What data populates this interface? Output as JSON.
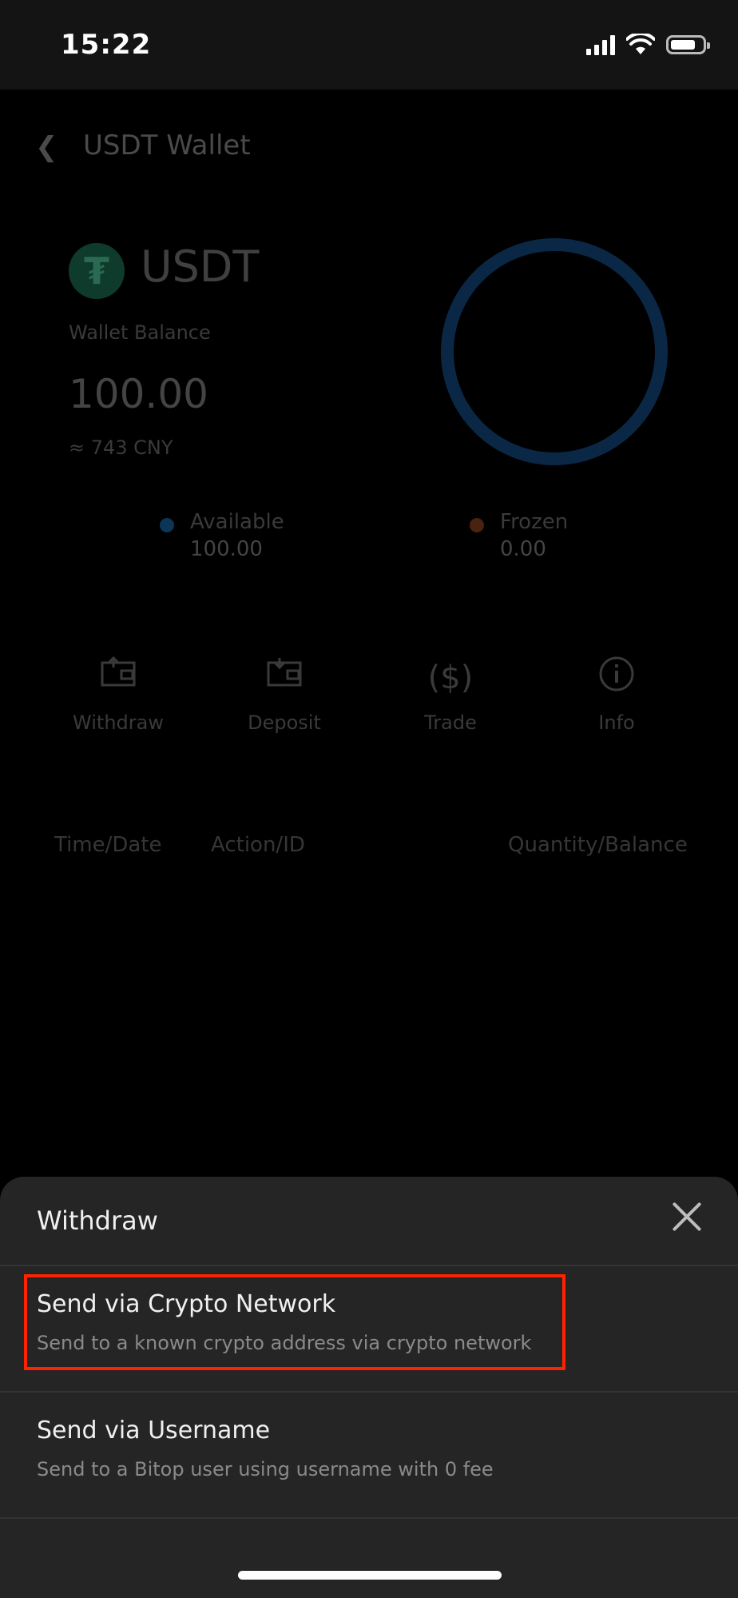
{
  "status": {
    "time": "15:22"
  },
  "header": {
    "title": "USDT Wallet"
  },
  "wallet": {
    "coin": "USDT",
    "coin_symbol": "₮",
    "balance_label": "Wallet Balance",
    "balance": "100.00",
    "balance_cny": "≈ 743 CNY",
    "available_label": "Available",
    "available_value": "100.00",
    "frozen_label": "Frozen",
    "frozen_value": "0.00"
  },
  "actions": [
    {
      "label": "Withdraw"
    },
    {
      "label": "Deposit"
    },
    {
      "label": "Trade"
    },
    {
      "label": "Info"
    }
  ],
  "table": {
    "columns": [
      "Time/Date",
      "Action/ID",
      "Quantity/Balance"
    ]
  },
  "sheet": {
    "title": "Withdraw",
    "options": [
      {
        "title": "Send via Crypto Network",
        "subtitle": "Send to a known crypto address via crypto network"
      },
      {
        "title": "Send via Username",
        "subtitle": "Send to a Bitop user using username with 0 fee"
      }
    ]
  },
  "colors": {
    "accent_highlight": "#ff2200",
    "sheet_background": "#252525",
    "available_dot": "#0c3556",
    "frozen_dot": "#4a2210"
  }
}
